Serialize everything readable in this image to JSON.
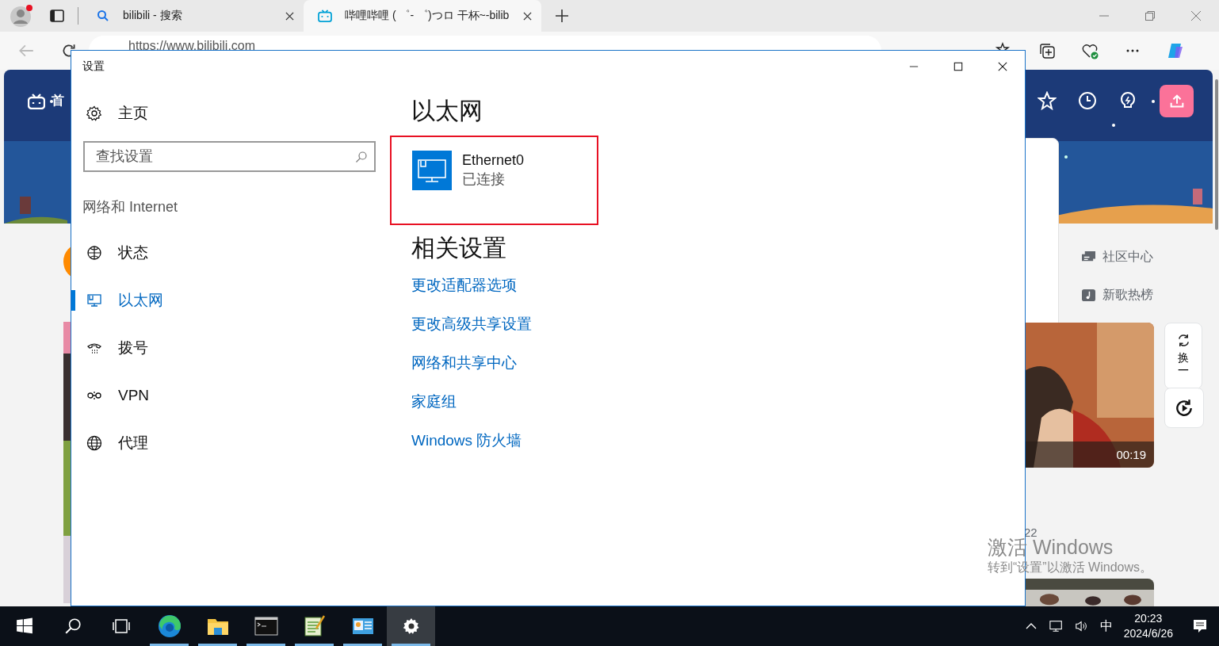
{
  "browser": {
    "tabs": [
      {
        "title": "bilibili - 搜索",
        "kind": "search",
        "selected": false
      },
      {
        "title": "哔哩哔哩 ( ゜- ゜)つロ 干杯~-bilib",
        "kind": "site",
        "selected": true
      }
    ],
    "address": "https://www.bilibili.com"
  },
  "page": {
    "nav_label": "首",
    "side_links": [
      {
        "label": "社区中心",
        "kind": "chat"
      },
      {
        "label": "新歌热榜",
        "kind": "music"
      }
    ],
    "refresh_label": [
      "换",
      "一"
    ],
    "video_duration": "00:19",
    "count": "22"
  },
  "settings": {
    "title": "设置",
    "home": "主页",
    "search": {
      "placeholder": "查找设置"
    },
    "section": "网络和 Internet",
    "items": [
      {
        "label": "状态",
        "kind": "status",
        "selected": false
      },
      {
        "label": "以太网",
        "kind": "ethernet",
        "selected": true
      },
      {
        "label": "拨号",
        "kind": "dialup",
        "selected": false
      },
      {
        "label": "VPN",
        "kind": "vpn",
        "selected": false
      },
      {
        "label": "代理",
        "kind": "proxy",
        "selected": false
      }
    ],
    "heading": "以太网",
    "adapter": {
      "name": "Ethernet0",
      "status": "已连接"
    },
    "related_heading": "相关设置",
    "links": [
      "更改适配器选项",
      "更改高级共享设置",
      "网络和共享中心",
      "家庭组",
      "Windows 防火墙"
    ]
  },
  "activation_notice": {
    "title": "激活 Windows",
    "subtitle": "转到“设置”以激活 Windows。"
  },
  "taskbar": {
    "apps": [
      {
        "kind": "start",
        "running": false,
        "selected": false
      },
      {
        "kind": "search",
        "running": false,
        "selected": false
      },
      {
        "kind": "taskview",
        "running": false,
        "selected": false
      },
      {
        "kind": "edge",
        "running": true,
        "selected": false
      },
      {
        "kind": "explorer",
        "running": true,
        "selected": false
      },
      {
        "kind": "terminal",
        "running": true,
        "selected": false
      },
      {
        "kind": "notepad",
        "running": true,
        "selected": false
      },
      {
        "kind": "control",
        "running": true,
        "selected": false
      },
      {
        "kind": "settings",
        "running": true,
        "selected": true
      }
    ],
    "ime": "中",
    "time": "20:23",
    "date": "2024/6/26"
  }
}
